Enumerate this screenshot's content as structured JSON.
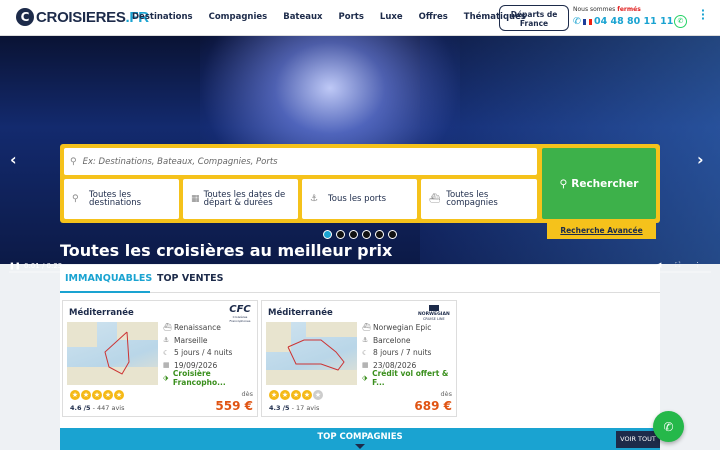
{
  "header": {
    "logo_text": "CROISIERES",
    "logo_tld": ".FR",
    "nav": [
      "Destinations",
      "Compagnies",
      "Bateaux",
      "Ports",
      "Luxe",
      "Offres",
      "Thématiques"
    ],
    "departures_line1": "Départs de",
    "departures_line2": "France",
    "open_prefix": "Nous sommes",
    "open_status": "fermés",
    "phone": "04 48 80 11 11"
  },
  "hero": {
    "title": "Toutes les croisières au meilleur prix",
    "video_time": "0:01 / 0:23",
    "slides_total": 6,
    "slide_active": 1
  },
  "search": {
    "placeholder": "Ex: Destinations, Bateaux, Compagnies, Ports",
    "destinations": "Toutes les destinations",
    "dates": "Toutes les dates de départ & durées",
    "ports": "Tous les ports",
    "companies": "Toutes les compagnies",
    "button": "Rechercher",
    "advanced": "Recherche Avancée"
  },
  "tabs": {
    "active": "IMMANQUABLES",
    "other": "TOP VENTES"
  },
  "cards": [
    {
      "destination": "Méditerranée",
      "company_logo": "CFC",
      "company_sub": "Croisières Francophones",
      "ship": "Renaissance",
      "port": "Marseille",
      "duration": "5 jours / 4 nuits",
      "date": "19/09/2026",
      "highlight": "Croisière Francopho...",
      "rating": "4.6",
      "rating_scale": "/5",
      "reviews": "447 avis",
      "stars_full": 5,
      "from_label": "dès",
      "price": "559 €"
    },
    {
      "destination": "Méditerranée",
      "company_logo": "NORWEGIAN",
      "company_sub": "CRUISE LINE",
      "ship": "Norwegian Epic",
      "port": "Barcelone",
      "duration": "8 jours / 7 nuits",
      "date": "23/08/2026",
      "highlight": "Crédit vol offert & F...",
      "rating": "4.3",
      "rating_scale": "/5",
      "reviews": "17 avis",
      "stars_full": 4,
      "from_label": "dès",
      "price": "689 €"
    }
  ],
  "footer_section": {
    "title": "TOP COMPAGNIES",
    "see_all": "VOIR TOUT"
  }
}
